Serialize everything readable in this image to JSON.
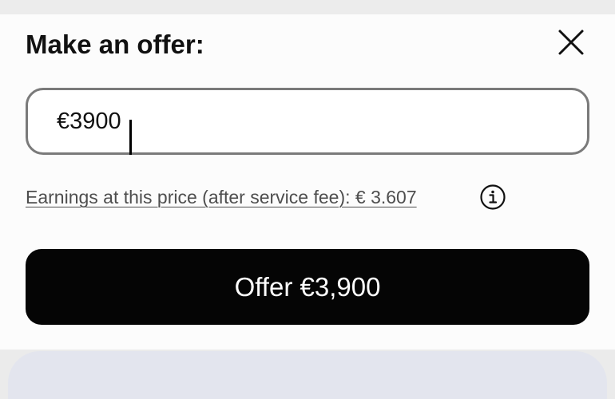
{
  "dialog": {
    "title": "Make an offer:",
    "close_icon": "close-icon"
  },
  "offer_input": {
    "value": "€3900"
  },
  "earnings": {
    "text": "Earnings at this price (after service fee): € 3.607",
    "info_icon": "info-icon"
  },
  "submit": {
    "label": "Offer €3,900"
  },
  "colors": {
    "sheet_background": "#fcfcfc",
    "input_border": "#7a7a7a",
    "button_background": "#050505",
    "button_text": "#ffffff",
    "link_text": "#4e4e4e",
    "bottom_panel": "#e3e5ee"
  }
}
